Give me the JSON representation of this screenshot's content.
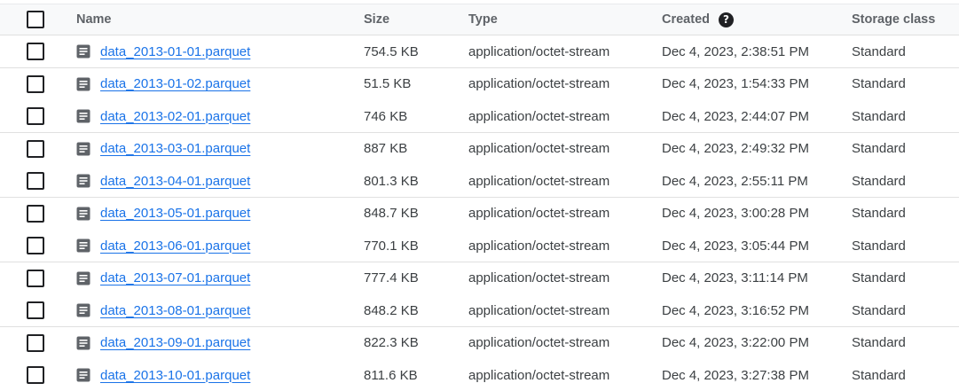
{
  "columns": {
    "name": "Name",
    "size": "Size",
    "type": "Type",
    "created": "Created",
    "storage_class": "Storage class"
  },
  "rows": [
    {
      "name": "data_2013-01-01.parquet",
      "size": "754.5 KB",
      "type": "application/octet-stream",
      "created": "Dec 4, 2023, 2:38:51 PM",
      "storage_class": "Standard"
    },
    {
      "name": "data_2013-01-02.parquet",
      "size": "51.5 KB",
      "type": "application/octet-stream",
      "created": "Dec 4, 2023, 1:54:33 PM",
      "storage_class": "Standard"
    },
    {
      "name": "data_2013-02-01.parquet",
      "size": "746 KB",
      "type": "application/octet-stream",
      "created": "Dec 4, 2023, 2:44:07 PM",
      "storage_class": "Standard"
    },
    {
      "name": "data_2013-03-01.parquet",
      "size": "887 KB",
      "type": "application/octet-stream",
      "created": "Dec 4, 2023, 2:49:32 PM",
      "storage_class": "Standard"
    },
    {
      "name": "data_2013-04-01.parquet",
      "size": "801.3 KB",
      "type": "application/octet-stream",
      "created": "Dec 4, 2023, 2:55:11 PM",
      "storage_class": "Standard"
    },
    {
      "name": "data_2013-05-01.parquet",
      "size": "848.7 KB",
      "type": "application/octet-stream",
      "created": "Dec 4, 2023, 3:00:28 PM",
      "storage_class": "Standard"
    },
    {
      "name": "data_2013-06-01.parquet",
      "size": "770.1 KB",
      "type": "application/octet-stream",
      "created": "Dec 4, 2023, 3:05:44 PM",
      "storage_class": "Standard"
    },
    {
      "name": "data_2013-07-01.parquet",
      "size": "777.4 KB",
      "type": "application/octet-stream",
      "created": "Dec 4, 2023, 3:11:14 PM",
      "storage_class": "Standard"
    },
    {
      "name": "data_2013-08-01.parquet",
      "size": "848.2 KB",
      "type": "application/octet-stream",
      "created": "Dec 4, 2023, 3:16:52 PM",
      "storage_class": "Standard"
    },
    {
      "name": "data_2013-09-01.parquet",
      "size": "822.3 KB",
      "type": "application/octet-stream",
      "created": "Dec 4, 2023, 3:22:00 PM",
      "storage_class": "Standard"
    },
    {
      "name": "data_2013-10-01.parquet",
      "size": "811.6 KB",
      "type": "application/octet-stream",
      "created": "Dec 4, 2023, 3:27:38 PM",
      "storage_class": "Standard"
    }
  ],
  "icons": {
    "file": "file-document-icon",
    "help": "help-circle-icon"
  },
  "colors": {
    "link": "#1a73e8",
    "header_bg": "#f8f9fa",
    "icon": "#5f6368"
  }
}
